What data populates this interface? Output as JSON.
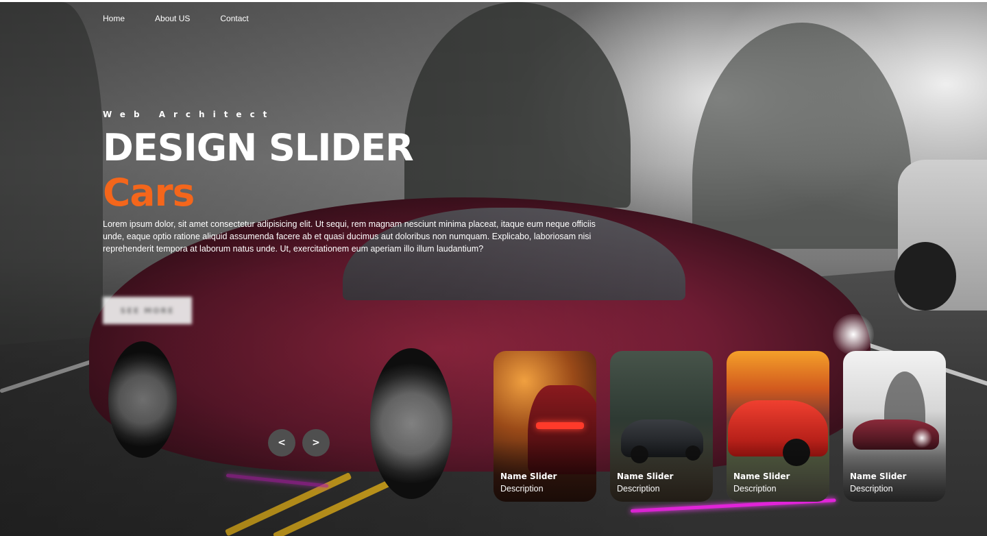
{
  "nav": {
    "items": [
      {
        "label": "Home"
      },
      {
        "label": "About US"
      },
      {
        "label": "Contact"
      }
    ]
  },
  "hero": {
    "eyebrow": "Web Architect",
    "title": "DESIGN SLIDER",
    "accent": "Cars",
    "description": "Lorem ipsum dolor, sit amet consectetur adipisicing elit. Ut sequi, rem magnam nesciunt minima placeat, itaque eum neque officiis unde, eaque optio ratione aliquid assumenda facere ab et quasi ducimus aut doloribus non numquam. Explicabo, laboriosam nisi reprehenderit tempora at laborum natus unde. Ut, exercitationem eum aperiam illo illum laudantium?",
    "button_label": "SEE MORE",
    "accent_color": "#f4661b"
  },
  "controls": {
    "prev_label": "<",
    "next_label": ">"
  },
  "thumbnails": [
    {
      "name": "Name Slider",
      "description": "Description"
    },
    {
      "name": "Name Slider",
      "description": "Description"
    },
    {
      "name": "Name Slider",
      "description": "Description"
    },
    {
      "name": "Name Slider",
      "description": "Description"
    }
  ]
}
